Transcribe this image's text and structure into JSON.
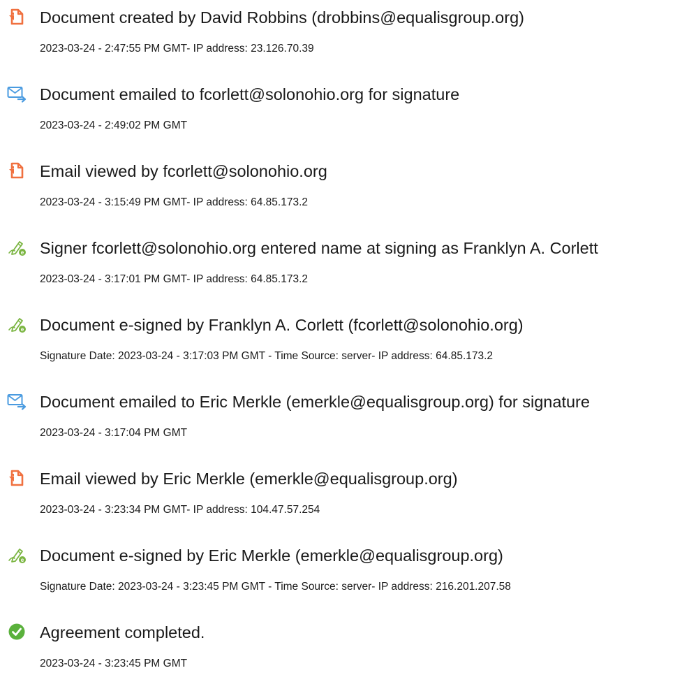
{
  "events": [
    {
      "icon": "document-icon",
      "title": "Document created by David Robbins (drobbins@equalisgroup.org)",
      "meta": "2023-03-24 - 2:47:55 PM GMT- IP address: 23.126.70.39"
    },
    {
      "icon": "email-sent-icon",
      "title": "Document emailed to fcorlett@solonohio.org for signature",
      "meta": "2023-03-24 - 2:49:02 PM GMT"
    },
    {
      "icon": "document-icon",
      "title": "Email viewed by fcorlett@solonohio.org",
      "meta": "2023-03-24 - 3:15:49 PM GMT- IP address: 64.85.173.2"
    },
    {
      "icon": "esign-pen-icon",
      "title": "Signer fcorlett@solonohio.org entered name at signing as Franklyn A. Corlett",
      "meta": "2023-03-24 - 3:17:01 PM GMT- IP address: 64.85.173.2"
    },
    {
      "icon": "esign-pen-icon",
      "title": "Document e-signed by Franklyn A. Corlett (fcorlett@solonohio.org)",
      "meta": "Signature Date: 2023-03-24 - 3:17:03 PM GMT - Time Source: server- IP address: 64.85.173.2"
    },
    {
      "icon": "email-sent-icon",
      "title": "Document emailed to Eric Merkle (emerkle@equalisgroup.org) for signature",
      "meta": "2023-03-24 - 3:17:04 PM GMT"
    },
    {
      "icon": "document-icon",
      "title": "Email viewed by Eric Merkle (emerkle@equalisgroup.org)",
      "meta": "2023-03-24 - 3:23:34 PM GMT- IP address: 104.47.57.254"
    },
    {
      "icon": "esign-pen-icon",
      "title": "Document e-signed by Eric Merkle (emerkle@equalisgroup.org)",
      "meta": "Signature Date: 2023-03-24 - 3:23:45 PM GMT - Time Source: server- IP address: 216.201.207.58"
    },
    {
      "icon": "check-circle-icon",
      "title": "Agreement completed.",
      "meta": "2023-03-24 - 3:23:45 PM GMT"
    }
  ],
  "colors": {
    "document_icon": "#F0703F",
    "email_icon": "#4A9BE0",
    "pen_icon": "#7BB542",
    "check_icon": "#5AB13C",
    "text": "#1a1a1a"
  }
}
